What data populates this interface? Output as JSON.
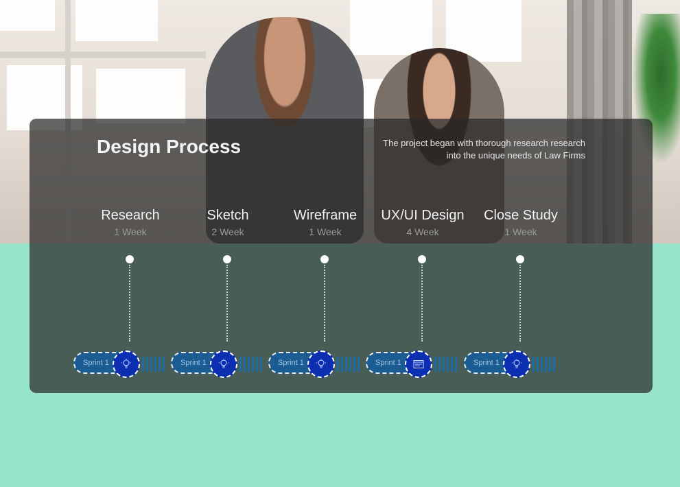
{
  "title": "Design Process",
  "description": "The project began with thorough research research into the unique needs of Law Firms",
  "stages": [
    {
      "name": "Research",
      "duration": "1 Week",
      "sprint": "Sprint 1",
      "icon": "lightbulb-icon"
    },
    {
      "name": "Sketch",
      "duration": "2 Week",
      "sprint": "Sprint 1",
      "icon": "lightbulb-icon"
    },
    {
      "name": "Wireframe",
      "duration": "1 Week",
      "sprint": "Sprint 1",
      "icon": "lightbulb-icon"
    },
    {
      "name": "UX/UI Design",
      "duration": "4 Week",
      "sprint": "Sprint 1",
      "icon": "browser-window-icon"
    },
    {
      "name": "Close Study",
      "duration": "1 Week",
      "sprint": "Sprint 1",
      "icon": "lightbulb-icon"
    }
  ],
  "colors": {
    "background": "#96e4cb",
    "panel": "#282828",
    "sprint_pill": "#1b5d92",
    "sprint_icon": "#0b2fb0"
  }
}
